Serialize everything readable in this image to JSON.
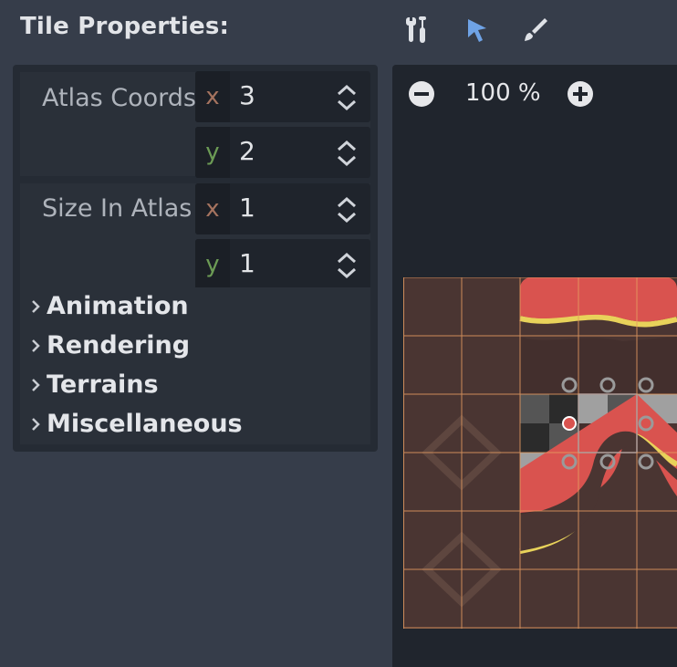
{
  "header": {
    "title": "Tile Properties:"
  },
  "toolbar": {
    "tools": [
      "tools-icon",
      "select-arrow-icon",
      "paint-brush-icon"
    ]
  },
  "properties": {
    "atlas_coords": {
      "label": "Atlas Coords",
      "x_axis": "x",
      "x": "3",
      "y_axis": "y",
      "y": "2"
    },
    "size_in_atlas": {
      "label": "Size In Atlas",
      "x_axis": "x",
      "x": "1",
      "y_axis": "y",
      "y": "1"
    }
  },
  "sections": [
    "Animation",
    "Rendering",
    "Terrains",
    "Miscellaneous"
  ],
  "editor": {
    "zoom": "100 %"
  },
  "colors": {
    "background": "#363d4a",
    "panel": "#252b34",
    "accent_blue": "#6fa3e6",
    "grid_line": "#e49b61",
    "tile_red": "#d9534f",
    "tile_yellow": "#e8d25a",
    "tile_brown": "#4a3532"
  }
}
